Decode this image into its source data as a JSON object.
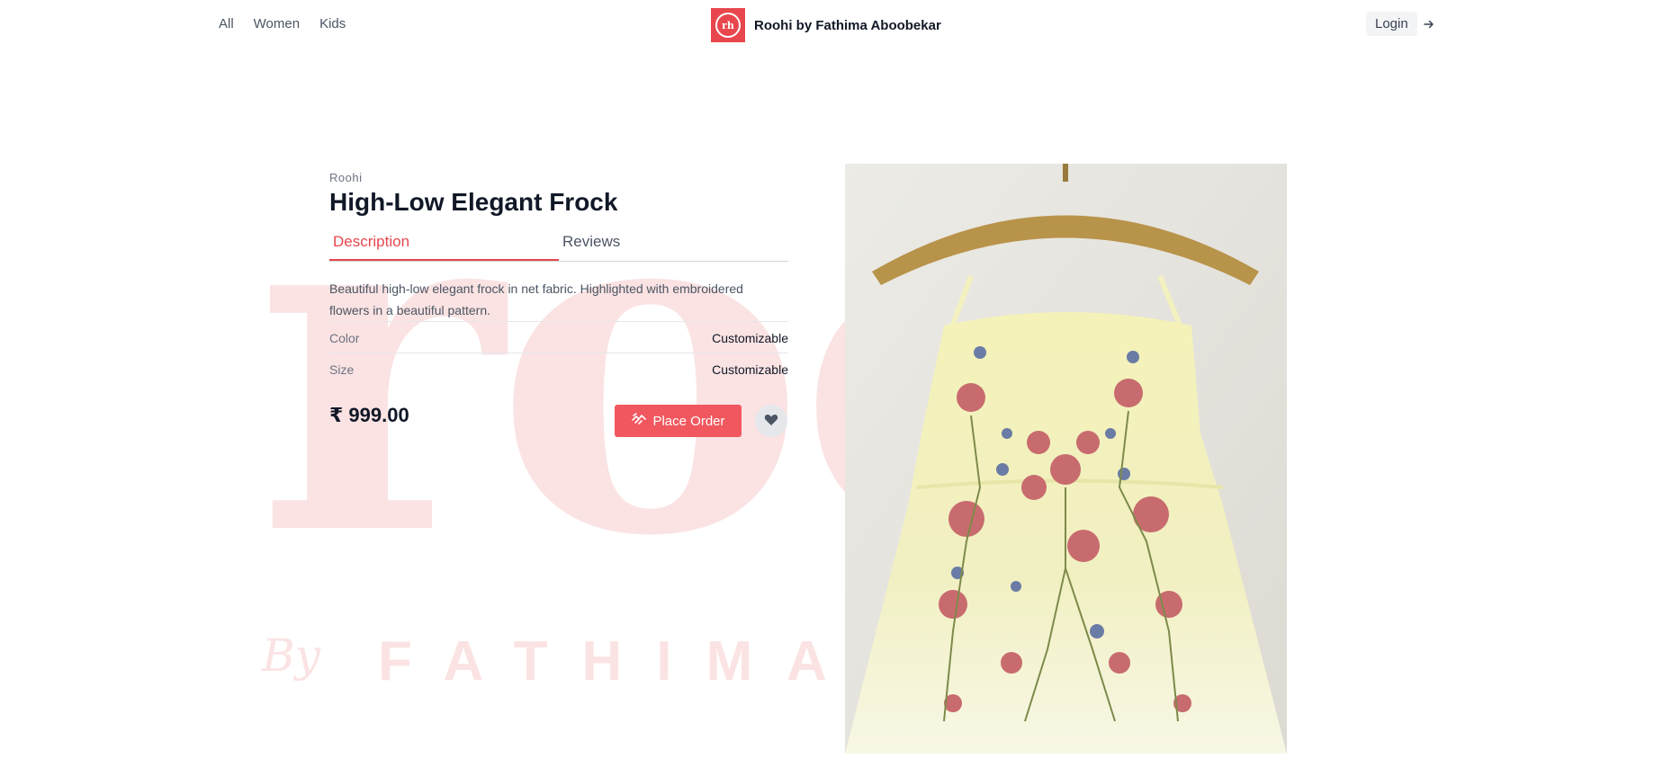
{
  "nav": {
    "items": [
      "All",
      "Women",
      "Kids"
    ]
  },
  "brand": {
    "logo_text": "rh",
    "name": "Roohi by Fathima Aboobekar"
  },
  "auth": {
    "login_label": "Login"
  },
  "watermark": {
    "big": "rooi",
    "by": "By",
    "name": "FATHIMA      R"
  },
  "product": {
    "brand": "Roohi",
    "title": "High-Low Elegant Frock",
    "tabs": [
      "Description",
      "Reviews"
    ],
    "description": "Beautiful high-low elegant frock in net fabric. Highlighted with embroidered flowers in a beautiful pattern.",
    "specs": [
      {
        "label": "Color",
        "value": "Customizable"
      },
      {
        "label": "Size",
        "value": "Customizable"
      }
    ],
    "price": "₹ 999.00",
    "order_label": "Place Order"
  },
  "colors": {
    "accent": "#e8474d",
    "button": "#f0575e",
    "watermark": "#fbe3e3"
  },
  "icons": {
    "login": "arrow-right-icon",
    "order": "order-hand-icon",
    "wishlist": "heart-icon"
  }
}
